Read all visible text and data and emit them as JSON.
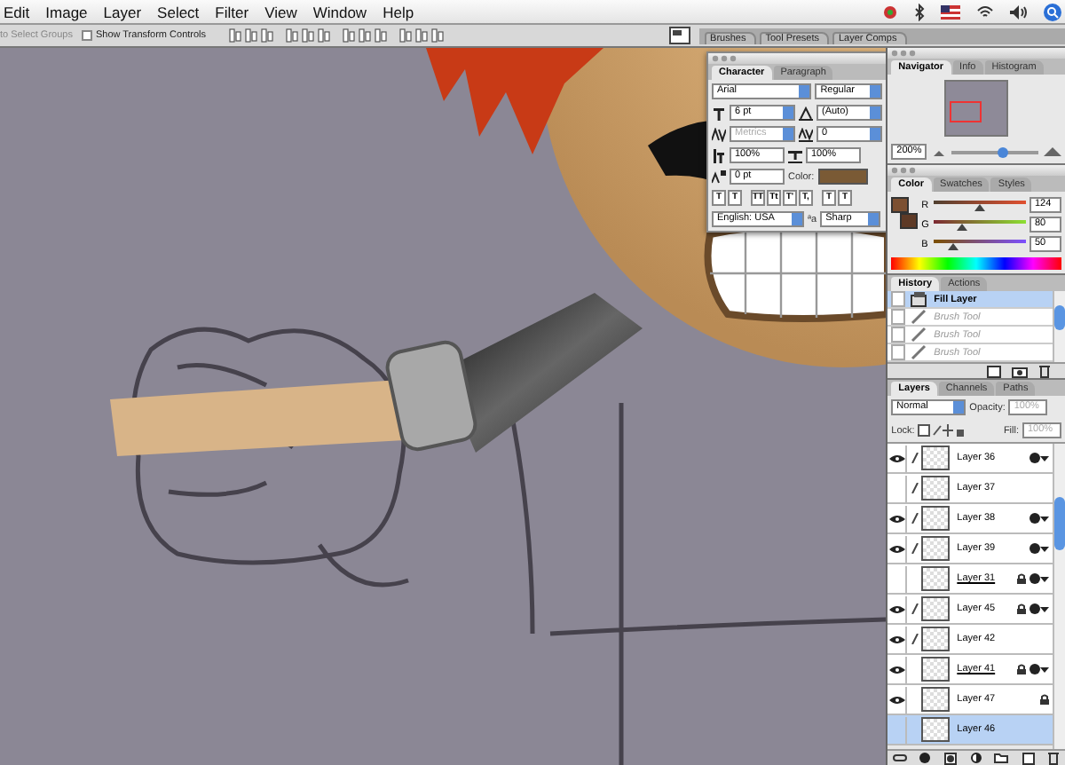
{
  "menu_bar": {
    "items": [
      "Edit",
      "Image",
      "Layer",
      "Select",
      "Filter",
      "View",
      "Window",
      "Help"
    ]
  },
  "options_bar": {
    "auto_select_label": "to Select Groups",
    "show_transform_controls": {
      "label": "Show Transform Controls",
      "checked": false
    },
    "palette_well_tabs": [
      "Brushes",
      "Tool Presets",
      "Layer Comps"
    ]
  },
  "character_panel": {
    "tabs": [
      {
        "label": "Character",
        "selected": true
      },
      {
        "label": "Paragraph",
        "selected": false
      }
    ],
    "font_family": "Arial",
    "font_style": "Regular",
    "font_size": "6 pt",
    "leading": "(Auto)",
    "kerning": "Metrics",
    "tracking": "0",
    "vertical_scale": "100%",
    "horizontal_scale": "100%",
    "baseline_shift": "0 pt",
    "color_label": "Color:",
    "style_buttons": [
      "T",
      "T",
      "TT",
      "Tt",
      "T'",
      "T,",
      "T",
      "T"
    ],
    "language": "English: USA",
    "anti_alias_label": "ªa",
    "anti_alias": "Sharp"
  },
  "navigator_panel": {
    "tabs": [
      {
        "label": "Navigator",
        "selected": true
      },
      {
        "label": "Info",
        "selected": false
      },
      {
        "label": "Histogram",
        "selected": false
      }
    ],
    "zoom": "200%",
    "zoom_slider": {
      "level": 0.6
    }
  },
  "color_panel": {
    "tabs": [
      {
        "label": "Color",
        "selected": true
      },
      {
        "label": "Swatches",
        "selected": false
      },
      {
        "label": "Styles",
        "selected": false
      }
    ],
    "channels": [
      {
        "name": "R",
        "value": "124",
        "level": 0.49
      },
      {
        "name": "G",
        "value": "80",
        "level": 0.31
      },
      {
        "name": "B",
        "value": "50",
        "level": 0.2
      }
    ]
  },
  "history_panel": {
    "tabs": [
      {
        "label": "History",
        "selected": true
      },
      {
        "label": "Actions",
        "selected": false
      }
    ],
    "items": [
      {
        "kind": "fill",
        "label": "Fill Layer",
        "selected": true,
        "undone": false
      },
      {
        "kind": "brush",
        "label": "Brush Tool",
        "selected": false,
        "undone": true
      },
      {
        "kind": "brush",
        "label": "Brush Tool",
        "selected": false,
        "undone": true
      },
      {
        "kind": "brush",
        "label": "Brush Tool",
        "selected": false,
        "undone": true
      }
    ]
  },
  "layers_panel": {
    "tabs": [
      {
        "label": "Layers",
        "selected": true
      },
      {
        "label": "Channels",
        "selected": false
      },
      {
        "label": "Paths",
        "selected": false
      }
    ],
    "blend_mode": "Normal",
    "opacity_label": "Opacity:",
    "opacity": "100%",
    "lock_label": "Lock:",
    "fill_label": "Fill:",
    "fill": "100%",
    "layers": [
      {
        "name": "Layer 36",
        "visible": true,
        "linked": true,
        "locked": false,
        "effects": true,
        "selected": false,
        "underlined": false
      },
      {
        "name": "Layer 37",
        "visible": false,
        "linked": true,
        "locked": false,
        "effects": false,
        "selected": false,
        "underlined": false
      },
      {
        "name": "Layer 38",
        "visible": true,
        "linked": true,
        "locked": false,
        "effects": true,
        "selected": false,
        "underlined": false
      },
      {
        "name": "Layer 39",
        "visible": true,
        "linked": true,
        "locked": false,
        "effects": true,
        "selected": false,
        "underlined": false
      },
      {
        "name": "Layer 31",
        "visible": false,
        "linked": false,
        "locked": true,
        "effects": true,
        "selected": false,
        "underlined": true
      },
      {
        "name": "Layer 45",
        "visible": true,
        "linked": true,
        "locked": true,
        "effects": true,
        "selected": false,
        "underlined": false
      },
      {
        "name": "Layer 42",
        "visible": true,
        "linked": true,
        "locked": false,
        "effects": false,
        "selected": false,
        "underlined": false
      },
      {
        "name": "Layer 41",
        "visible": true,
        "linked": false,
        "locked": true,
        "effects": true,
        "selected": false,
        "underlined": true
      },
      {
        "name": "Layer 47",
        "visible": true,
        "linked": false,
        "locked": true,
        "effects": false,
        "selected": false,
        "underlined": false
      },
      {
        "name": "Layer 46",
        "visible": false,
        "linked": false,
        "locked": false,
        "effects": false,
        "selected": true,
        "underlined": false
      }
    ]
  }
}
